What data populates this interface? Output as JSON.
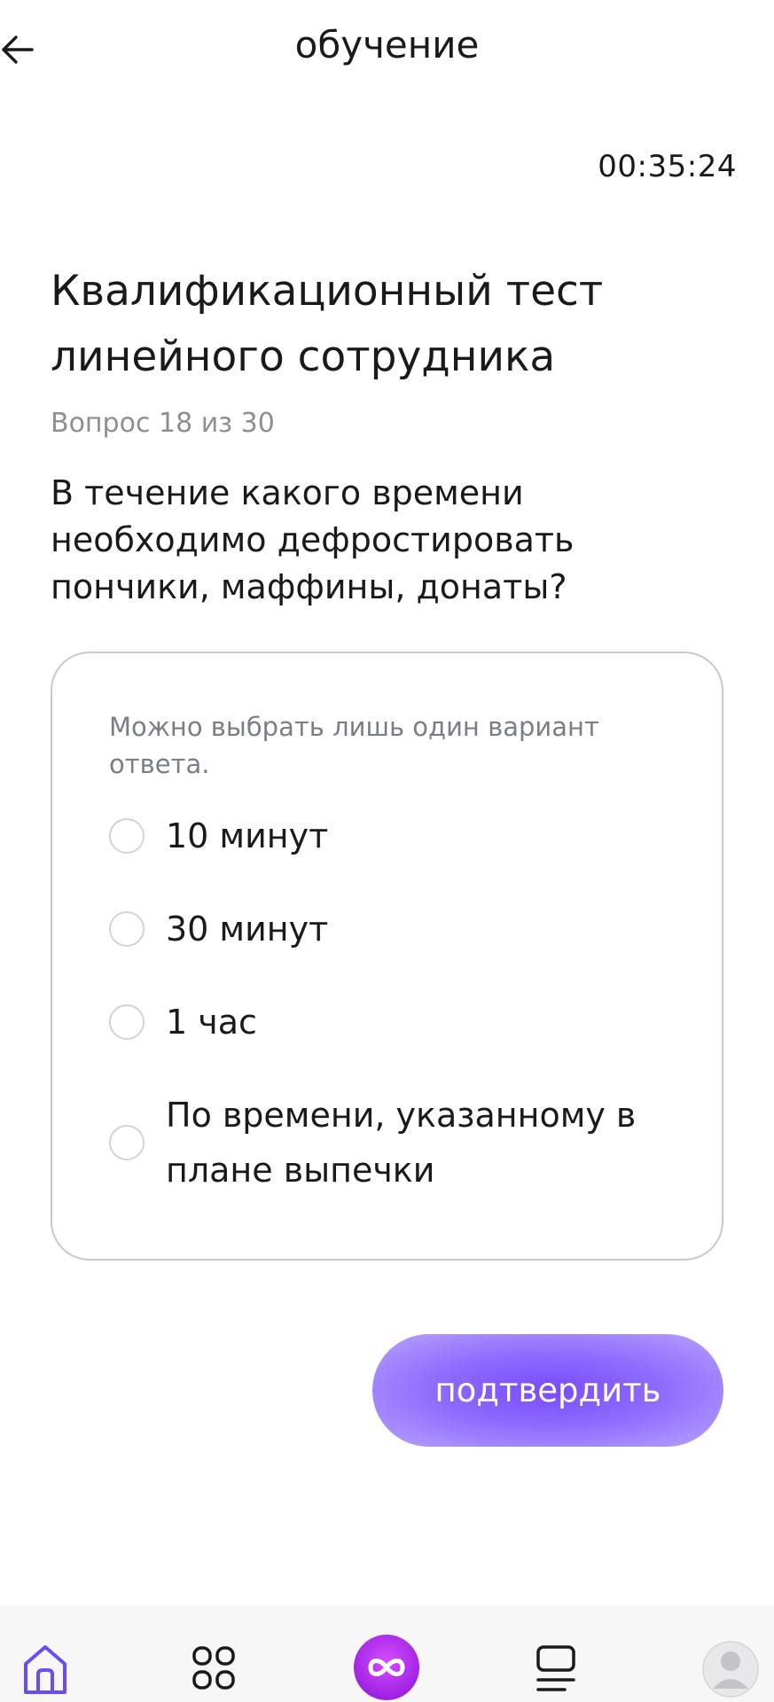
{
  "header": {
    "title": "обучение",
    "back_icon": "arrow-left-icon"
  },
  "timer": "00:35:24",
  "test": {
    "title": "Квалификационный тест линейного сотрудника",
    "counter": "Вопрос 18 из 30",
    "question": "В течение какого времени необходимо дефростировать пончики, маффины, донаты?"
  },
  "answers": {
    "hint": "Можно выбрать лишь один вариант ответа.",
    "options": [
      {
        "label": "10 минут",
        "selected": false
      },
      {
        "label": "30 минут",
        "selected": false
      },
      {
        "label": "1 час",
        "selected": false
      },
      {
        "label": "По времени, указанному в плане выпечки",
        "selected": false
      }
    ]
  },
  "confirm_label": "подтвердить",
  "colors": {
    "accent": "#7a4bff",
    "nav_active": "#6b4cf0",
    "card_border": "#c6c9ce"
  },
  "bottom_nav": {
    "items": [
      {
        "icon": "home-icon",
        "active": true
      },
      {
        "icon": "grid-icon",
        "active": false
      },
      {
        "icon": "infinity-logo-icon",
        "active": false
      },
      {
        "icon": "list-icon",
        "active": false
      },
      {
        "icon": "profile-avatar-icon",
        "active": false
      }
    ]
  }
}
